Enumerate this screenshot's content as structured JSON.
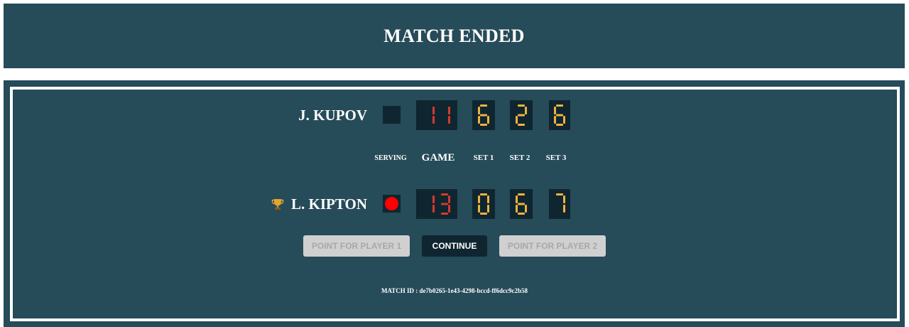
{
  "header": {
    "title": "MATCH ENDED"
  },
  "players": [
    {
      "name": "J. KUPOV",
      "winner": false,
      "serving": false,
      "game": "11",
      "sets": [
        "6",
        "2",
        "6"
      ]
    },
    {
      "name": "L. KIPTON",
      "winner": true,
      "serving": true,
      "game": "13",
      "sets": [
        "0",
        "6",
        "7"
      ]
    }
  ],
  "columns": {
    "serving": "SERVING",
    "game": "GAME",
    "set1": "SET 1",
    "set2": "SET 2",
    "set3": "SET 3"
  },
  "buttons": {
    "point_p1": "POINT FOR PLAYER 1",
    "continue": "CONTINUE",
    "point_p2": "POINT FOR PLAYER 2"
  },
  "match_id_label": "MATCH ID : de7b0265-1e43-4298-bccd-ff6dcc9c2b58",
  "icons": {
    "winner": "trophy-icon",
    "serving": "serving-indicator"
  },
  "colors": {
    "panel": "#264b59",
    "digit_bg": "#0f2631",
    "game_digits": "#d63a2c",
    "set_digits": "#f0b43c",
    "serve_dot": "#ff0000"
  }
}
